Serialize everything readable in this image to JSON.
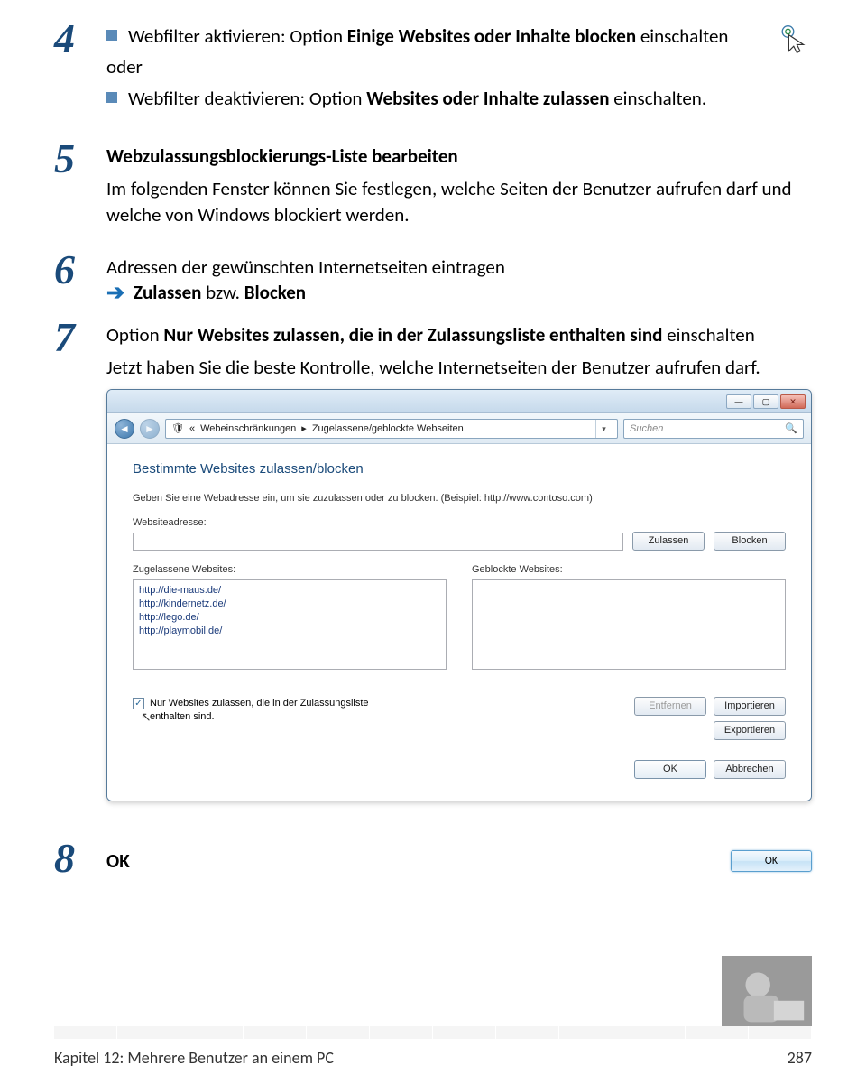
{
  "steps": {
    "s4": {
      "num": "4",
      "line1_prefix": "Webfilter aktivieren: Option ",
      "line1_bold": "Einige Websites oder Inhalte blocken",
      "line1_suffix": " einschalten",
      "oder": "oder",
      "line2_prefix": "Webfilter deaktivieren: Option ",
      "line2_bold": "Websites oder Inhalte zulassen",
      "line2_suffix": " einschalten."
    },
    "s5": {
      "num": "5",
      "heading": "Webzulassungsblockierungs-Liste bearbeiten",
      "body": "Im folgenden Fenster können Sie festlegen, welche Seiten der Benutzer aufrufen darf und welche von Windows blockiert werden."
    },
    "s6": {
      "num": "6",
      "line1": "Adressen der gewünschten Internetseiten eintragen",
      "line2_bold": "Zulassen",
      "line2_mid": " bzw. ",
      "line2_bold2": "Blocken"
    },
    "s7": {
      "num": "7",
      "line1_prefix": "Option ",
      "line1_bold": "Nur Websites zulassen, die in der Zulassungsliste enthalten sind",
      "line1_suffix": " einschalten",
      "body": "Jetzt haben Sie die beste Kontrolle, welche Internetseiten der Benutzer aufrufen darf."
    },
    "s8": {
      "num": "8",
      "label": "OK"
    }
  },
  "window": {
    "breadcrumb_chev": "«",
    "breadcrumb_a": "Webeinschränkungen",
    "breadcrumb_sep": "▸",
    "breadcrumb_b": "Zugelassene/geblockte Webseiten",
    "search_placeholder": "Suchen",
    "heading": "Bestimmte Websites zulassen/blocken",
    "intro": "Geben Sie eine Webadresse ein, um sie zuzulassen oder zu blocken. (Beispiel: http://www.contoso.com)",
    "label_addr": "Websiteadresse:",
    "btn_allow": "Zulassen",
    "btn_block": "Blocken",
    "label_allowed": "Zugelassene Websites:",
    "label_blocked": "Geblockte Websites:",
    "allowed_sites": [
      "http://die-maus.de/",
      "http://kindernetz.de/",
      "http://lego.de/",
      "http://playmobil.de/"
    ],
    "chk_label": "Nur Websites zulassen, die in der Zulassungsliste enthalten sind.",
    "btn_remove": "Entfernen",
    "btn_import": "Importieren",
    "btn_export": "Exportieren",
    "btn_ok": "OK",
    "btn_cancel": "Abbrechen"
  },
  "ok_button_label": "OK",
  "footer": {
    "chapter": "Kapitel 12: Mehrere Benutzer an einem PC",
    "page": "287"
  }
}
